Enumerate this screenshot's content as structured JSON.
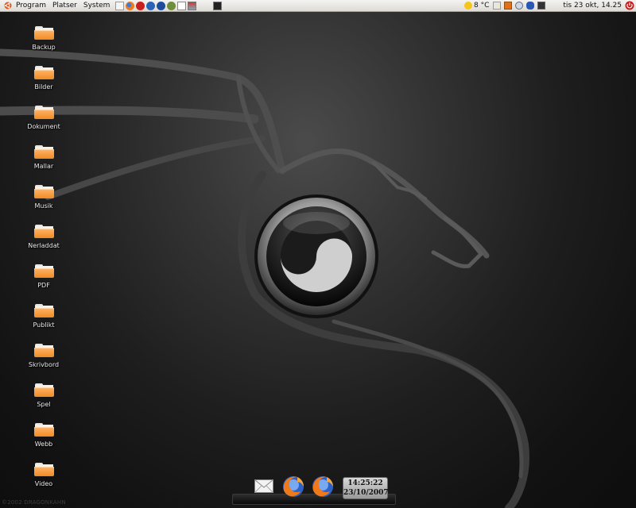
{
  "top_panel": {
    "menus": [
      "Program",
      "Platser",
      "System"
    ],
    "launchers": [
      "notes-icon",
      "firefox-icon",
      "evolution-icon",
      "web-icon",
      "help-icon",
      "gimp-icon",
      "text-editor-icon",
      "photo-icon",
      "terminal-icon"
    ],
    "weather_temp": "8 °C",
    "clock": "tis 23 okt, 14.25"
  },
  "desktop": {
    "icons": [
      {
        "label": "Backup"
      },
      {
        "label": "Bilder"
      },
      {
        "label": "Dokument"
      },
      {
        "label": "Mallar"
      },
      {
        "label": "Musik"
      },
      {
        "label": "Nerladdat"
      },
      {
        "label": "PDF"
      },
      {
        "label": "Publikt"
      },
      {
        "label": "Skrivbord"
      },
      {
        "label": "Spel"
      },
      {
        "label": "Webb"
      },
      {
        "label": "Video"
      }
    ],
    "watermark": "©2002 DRAGONKAHN"
  },
  "dock": {
    "items": [
      "mail-icon",
      "firefox-icon",
      "firefox-icon"
    ],
    "clock_time": "14:25:22",
    "clock_date": "23/10/2007"
  },
  "colors": {
    "panel_bg": "#dedbd6",
    "folder_orange": "#f08a24",
    "desktop_bg": "#1e1e1e"
  }
}
